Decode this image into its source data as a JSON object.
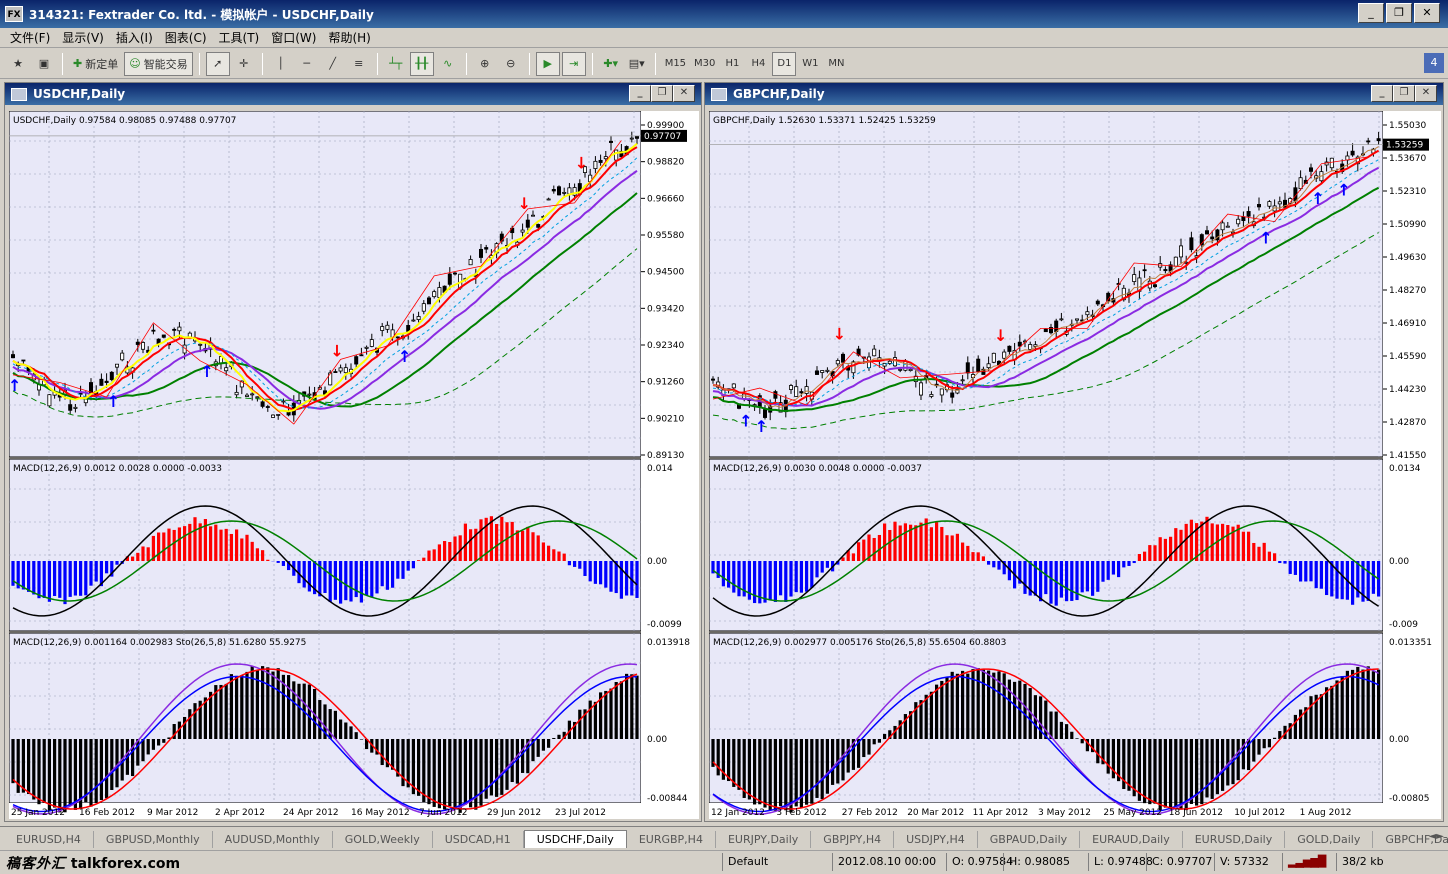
{
  "window": {
    "title": "314321: Fextrader Co. ltd. - 模拟帐户 - USDCHF,Daily",
    "app_icon": "FX",
    "buttons": [
      "minimize-icon",
      "restore-icon",
      "close-icon"
    ]
  },
  "menu": [
    "文件(F)",
    "显示(V)",
    "插入(I)",
    "图表(C)",
    "工具(T)",
    "窗口(W)",
    "帮助(H)"
  ],
  "toolbar": {
    "new_order": "新定单",
    "expert": "智能交易",
    "timeframes": [
      "M15",
      "M30",
      "H1",
      "H4",
      "D1",
      "W1",
      "MN"
    ],
    "active_timeframe": "D1",
    "corner_badge": "4"
  },
  "charts": [
    {
      "title": "USDCHF,Daily",
      "info": "USDCHF,Daily  0.97584 0.98085 0.97488 0.97707",
      "price_ticks": [
        "0.99900",
        "0.98820",
        "0.96660",
        "0.95580",
        "0.94500",
        "0.93420",
        "0.92340",
        "0.91260",
        "0.90210",
        "0.89130"
      ],
      "current_price": "0.97707",
      "macd_info": "MACD(12,26,9) 0.0012 0.0028 0.0000 -0.0033",
      "macd_ticks": [
        "0.014",
        "0.00",
        "-0.0099"
      ],
      "sto_info": "MACD(12,26,9) 0.001164 0.002983  Sto(26,5,8) 51.6280 55.9275",
      "sto_ticks": [
        "0.013918",
        "0.00",
        "-0.00844"
      ],
      "dates": [
        "25 Jan 2012",
        "16 Feb 2012",
        "9 Mar 2012",
        "2 Apr 2012",
        "24 Apr 2012",
        "16 May 2012",
        "7 Jun 2012",
        "29 Jun 2012",
        "23 Jul 2012"
      ]
    },
    {
      "title": "GBPCHF,Daily",
      "info": "GBPCHF,Daily  1.52630 1.53371 1.52425 1.53259",
      "price_ticks": [
        "1.55030",
        "1.53670",
        "1.52310",
        "1.50990",
        "1.49630",
        "1.48270",
        "1.46910",
        "1.45590",
        "1.44230",
        "1.42870",
        "1.41550"
      ],
      "current_price": "1.53259",
      "macd_info": "MACD(12,26,9) 0.0030 0.0048 0.0000 -0.0037",
      "macd_ticks": [
        "0.0134",
        "0.00",
        "-0.009"
      ],
      "sto_info": "MACD(12,26,9) 0.002977 0.005176  Sto(26,5,8) 55.6504 60.8803",
      "sto_ticks": [
        "0.013351",
        "0.00",
        "-0.00805"
      ],
      "dates": [
        "12 Jan 2012",
        "3 Feb 2012",
        "27 Feb 2012",
        "20 Mar 2012",
        "11 Apr 2012",
        "3 May 2012",
        "25 May 2012",
        "18 Jun 2012",
        "10 Jul 2012",
        "1 Aug 2012"
      ]
    }
  ],
  "tabs": [
    "EURUSD,H4",
    "GBPUSD,Monthly",
    "AUDUSD,Monthly",
    "GOLD,Weekly",
    "USDCAD,H1",
    "USDCHF,Daily",
    "EURGBP,H4",
    "EURJPY,Daily",
    "GBPJPY,H4",
    "USDJPY,H4",
    "GBPAUD,Daily",
    "EURAUD,Daily",
    "EURUSD,Daily",
    "GOLD,Daily",
    "GBPCHF,Daily"
  ],
  "active_tab": "USDCHF,Daily",
  "status": {
    "logo_cn": "稿客外汇",
    "logo_en": "talkforex.com",
    "profile": "Default",
    "datetime": "2012.08.10 00:00",
    "open": "O: 0.97584",
    "high": "H: 0.98085",
    "low": "L: 0.97488",
    "close": "C: 0.97707",
    "volume": "V: 57332",
    "traffic": "38/2 kb"
  },
  "colors": {
    "chart_bg": "#e8e8f8",
    "bull_hist": "#ff0000",
    "bear_hist": "#0000ff",
    "ma_red": "#ff0000",
    "ma_green": "#008000",
    "ma_purple": "#8a2be2",
    "ma_yellow": "#ffff00"
  }
}
